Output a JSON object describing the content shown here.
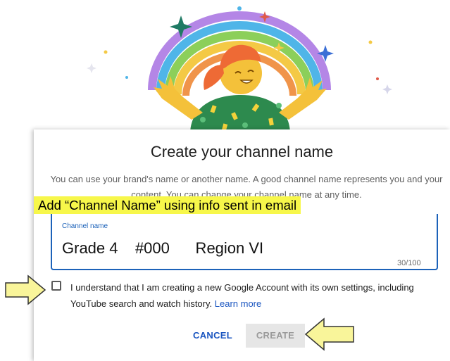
{
  "dialog": {
    "title": "Create your channel name",
    "subtitle": "You can use your brand's name or another name. A good channel name represents you and your content. You can change your channel name at any time.",
    "callout": "Add “Channel Name” using info sent in email",
    "channel_name": {
      "label": "Channel name",
      "value": "Grade 4    #000      Region VI",
      "counter": "30/100"
    },
    "consent": {
      "text": "I understand that I am creating a new Google Account with its own settings, including YouTube search and watch history.",
      "link": "Learn more",
      "checked": false
    },
    "buttons": {
      "cancel": "CANCEL",
      "create": "CREATE"
    }
  },
  "colors": {
    "accent": "#1c62b9",
    "link": "#1a55c0",
    "callout_highlight": "#f7f74a",
    "arrow_fill": "#f9f59a"
  },
  "icons": [
    "rainbow-illustration",
    "arrow-right-icon",
    "arrow-left-icon"
  ]
}
